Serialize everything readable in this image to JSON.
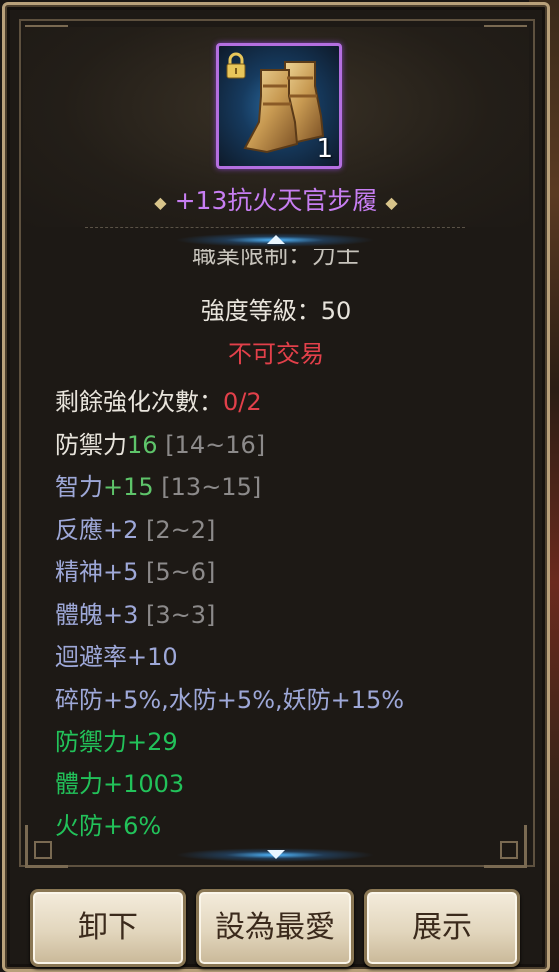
{
  "item": {
    "name": "+13抗火天官步履",
    "quantity": "1",
    "rarity_color": "#c77ef2",
    "icon": "boots-icon",
    "locked": true
  },
  "stats": {
    "job_restriction_partial": "職業限制：力士",
    "strength_level": "強度等級：50",
    "trade": "不可交易",
    "enhance_label": "剩餘強化次數：",
    "enhance_value": "0/2",
    "defense_label": "防禦力",
    "defense_value": "16",
    "defense_range": "[14~16]",
    "int_label": "智力",
    "int_value": "+15",
    "int_range": "[13~15]",
    "reflex": "反應+2",
    "reflex_range": "[2~2]",
    "spirit": "精神+5",
    "spirit_range": "[5~6]",
    "physique": "體魄+3",
    "physique_range": "[3~3]",
    "evasion": "迴避率+10",
    "resist": "碎防+5%,水防+5%,妖防+15%",
    "bonus_defense": "防禦力+29",
    "bonus_hp": "體力+1003",
    "bonus_fire": "火防+6%"
  },
  "buttons": {
    "unequip": "卸下",
    "favorite": "設為最愛",
    "show": "展示"
  }
}
